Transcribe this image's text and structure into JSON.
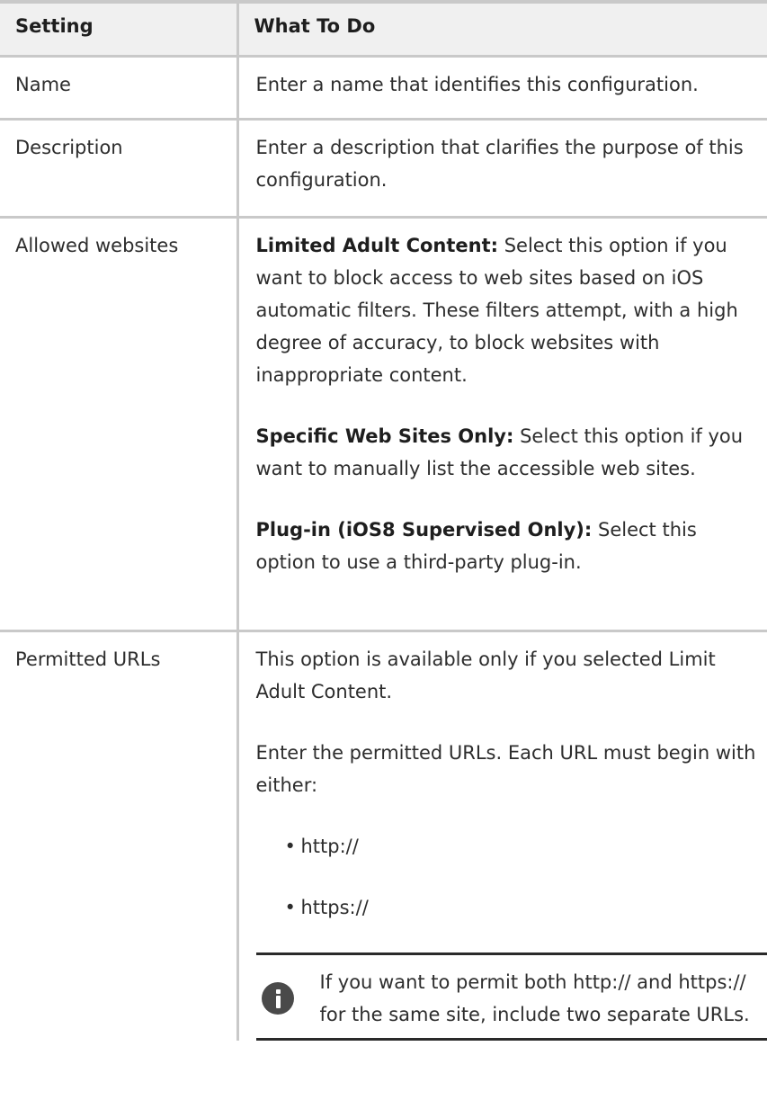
{
  "headers": {
    "setting": "Setting",
    "what_to_do": "What To Do"
  },
  "rows": [
    {
      "setting": "Name",
      "text": "Enter a name that identifies this configuration."
    },
    {
      "setting": "Description",
      "text": "Enter a description that clarifies the purpose of this configuration."
    },
    {
      "setting": "Allowed websites",
      "options": [
        {
          "label": "Limited Adult Content:",
          "text": "Select this option if you want to block access to web sites based on iOS automatic filters. These filters attempt, with a high degree of accuracy, to block websites with inappropriate content."
        },
        {
          "label": "Specific Web Sites Only:",
          "text": "Select this option if you want to manually list the accessible web sites."
        },
        {
          "label": "Plug-in (iOS8 Supervised Only):",
          "text": "Select this option to use a third-party plug-in."
        }
      ]
    },
    {
      "setting": "Permitted URLs",
      "intro": "This option is available only if you selected Limit Adult Content.",
      "instruction": "Enter the permitted URLs. Each URL must begin with either:",
      "bullets": [
        "http://",
        "https://"
      ],
      "note": "If you want to permit both http:// and https:// for the same site, include two separate URLs.",
      "note_icon": "info-icon"
    }
  ]
}
